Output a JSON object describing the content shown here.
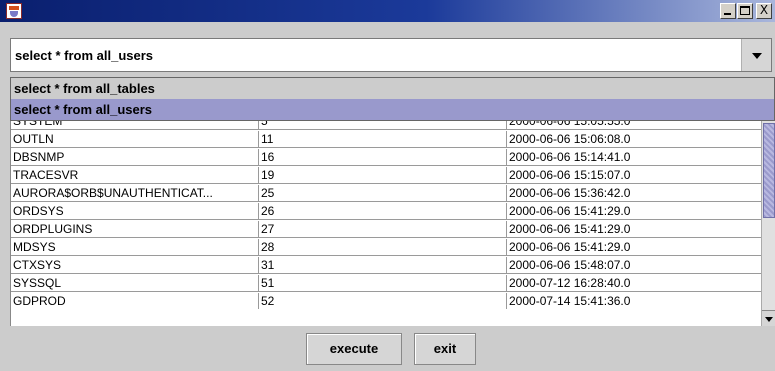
{
  "window": {
    "icon": "java-cup-icon",
    "controls": {
      "minimize": "minimize-icon",
      "maximize": "maximize-icon",
      "close_label": "X"
    }
  },
  "query_combo": {
    "selected": "select * from all_users",
    "options": [
      "select * from all_tables",
      "select * from all_users"
    ],
    "highlighted_index": 1
  },
  "table": {
    "rows": [
      [
        "SYSTEM",
        "5",
        "2000-06-06 15:05:55.0"
      ],
      [
        "OUTLN",
        "11",
        "2000-06-06 15:06:08.0"
      ],
      [
        "DBSNMP",
        "16",
        "2000-06-06 15:14:41.0"
      ],
      [
        "TRACESVR",
        "19",
        "2000-06-06 15:15:07.0"
      ],
      [
        "AURORA$ORB$UNAUTHENTICAT...",
        "25",
        "2000-06-06 15:36:42.0"
      ],
      [
        "ORDSYS",
        "26",
        "2000-06-06 15:41:29.0"
      ],
      [
        "ORDPLUGINS",
        "27",
        "2000-06-06 15:41:29.0"
      ],
      [
        "MDSYS",
        "28",
        "2000-06-06 15:41:29.0"
      ],
      [
        "CTXSYS",
        "31",
        "2000-06-06 15:48:07.0"
      ],
      [
        "SYSSQL",
        "51",
        "2000-07-12 16:28:40.0"
      ],
      [
        "GDPROD",
        "52",
        "2000-07-14 15:41:36.0"
      ]
    ]
  },
  "buttons": {
    "execute": "execute",
    "exit": "exit"
  },
  "colors": {
    "selection": "#9999cc",
    "background": "#cccccc"
  }
}
